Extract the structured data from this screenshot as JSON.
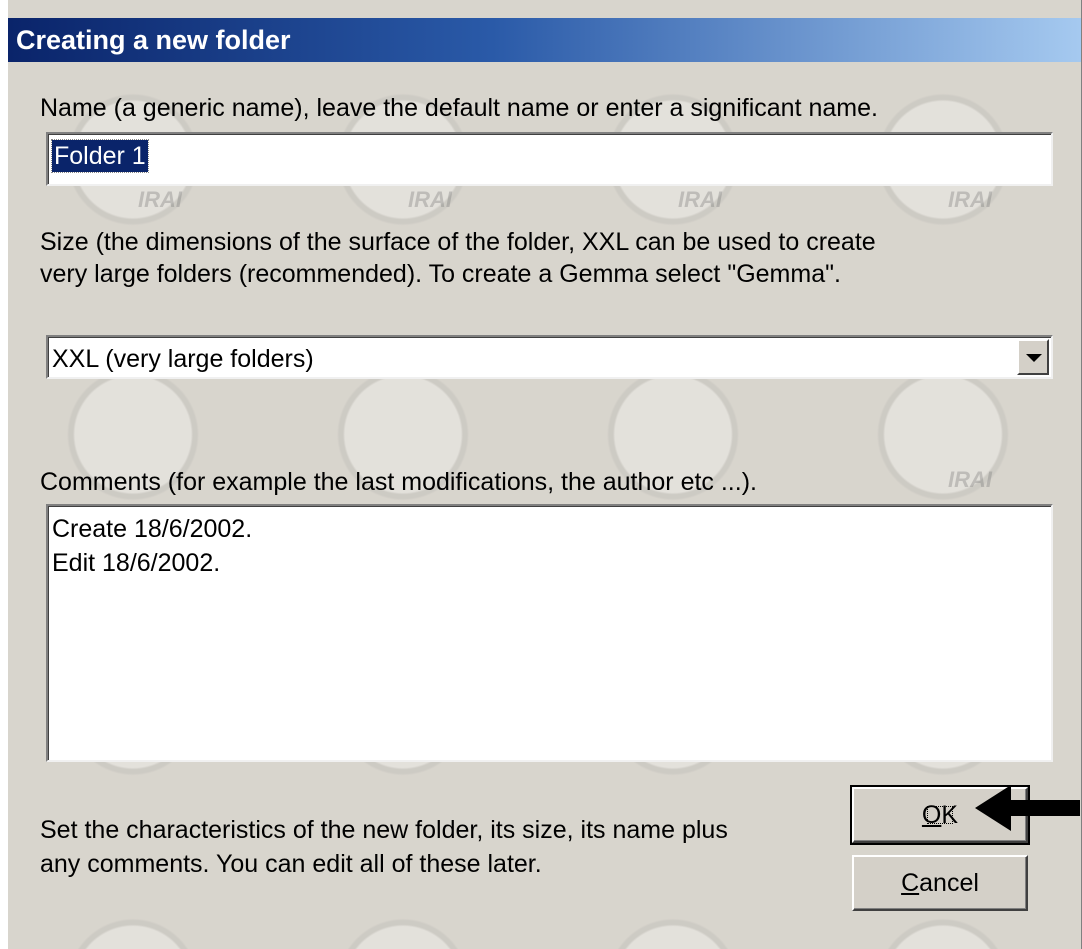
{
  "window": {
    "title": "Creating a new folder"
  },
  "watermark": {
    "text": "IRAI"
  },
  "name": {
    "label": "Name (a generic name), leave the default name or enter a significant name.",
    "value": "Folder 1"
  },
  "size": {
    "label_line1": "Size (the dimensions of the surface of the folder, XXL can be used to create",
    "label_line2": "very large folders (recommended). To create a Gemma select \"Gemma\".",
    "selected": "XXL (very large folders)"
  },
  "comments": {
    "label": "Comments (for example the last modifications, the author etc ...).",
    "line1": "Create 18/6/2002.",
    "line2": "Edit 18/6/2002."
  },
  "hint": {
    "line1": "Set the characteristics of the new folder, its size, its name plus",
    "line2": "any comments. You can edit all of these later."
  },
  "buttons": {
    "ok_mnemonic": "O",
    "ok_rest": "K",
    "cancel_mnemonic": "C",
    "cancel_rest": "ancel"
  },
  "icons": {
    "combo_dropdown": "chevron-down-icon",
    "pointer": "arrow-left-icon"
  },
  "colors": {
    "title_start": "#0a246a",
    "title_end": "#a6caf0",
    "selection": "#0a246a",
    "face": "#d4d0c8"
  }
}
